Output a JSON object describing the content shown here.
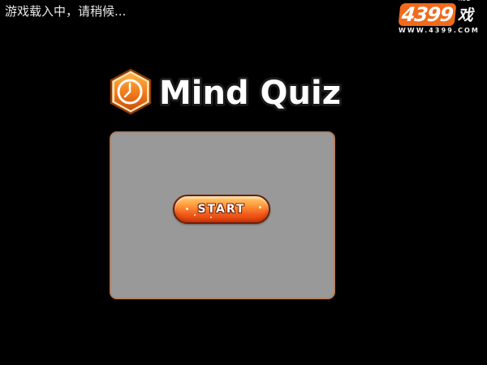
{
  "loading": {
    "text": "游戏载入中，请稍候..."
  },
  "brand": {
    "number": "4399",
    "cn_name": "游戏",
    "url": "WWW.4399.COM"
  },
  "game": {
    "title": "Mind Quiz",
    "logo_icon": "clock-icon"
  },
  "start_button": {
    "label": "START"
  },
  "colors": {
    "background": "#000000",
    "panel": "#999999",
    "panel_border": "#d4763a",
    "accent_orange": "#f26a1b",
    "button_outline": "#6b1f08"
  }
}
